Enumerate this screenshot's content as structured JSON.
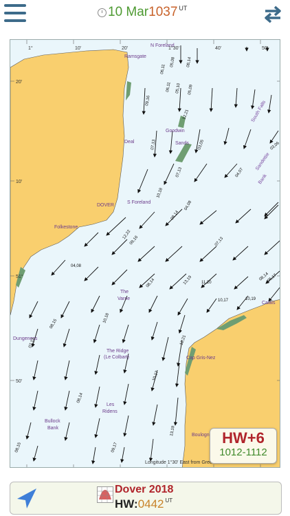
{
  "topbar": {
    "date": "10 Mar",
    "time": "1037",
    "ut": "UT"
  },
  "chart": {
    "places": {
      "north_foreland": "N Foreland",
      "ramsgate": "Ramsgate",
      "deal": "Deal",
      "dover": "DOVER",
      "s_foreland": "S Foreland",
      "folkestone": "Folkestone",
      "dungeness": "Dungeness",
      "goodwin": "Goodwin",
      "sands": "Sands",
      "south_falls": "South Falls",
      "sandettie": "Sandettie",
      "bank": "Bank",
      "the_varne": "The\nVarne",
      "the_ridge": "The Ridge",
      "le_colbart": "(Le Colbart)",
      "les_ridens": "Les\nRidens",
      "bullock_bank": "Bullock\nBank",
      "calais": "Calais",
      "cap_gris_nez": "Cap Gris-Nez",
      "boulogne": "Boulogne"
    },
    "longitude_caption": "Longitude 1°30' East from Greenwich",
    "top_ticks": [
      "1°",
      "10'",
      "20'",
      "1°30'",
      "40'",
      "50'"
    ],
    "side_ticks": [
      "20'",
      "10'",
      "51°",
      "50'"
    ],
    "rates": [
      "06,11",
      "05,08",
      "08,14",
      "09,16",
      "06,11",
      "05,10",
      "05,09",
      "12,21",
      "07,13",
      "03,05",
      "03,06",
      "04,07",
      "10,18",
      "07,13",
      "04,08",
      "12,22",
      "08,14",
      "09,16",
      "07,13",
      "04,08",
      "08,14",
      "13,19",
      "11,20",
      "08,14",
      "05,17",
      "10,17",
      "10,19",
      "08,15",
      "10,18",
      "07,13",
      "12,21",
      "10,17",
      "08,14",
      "13,19",
      "08,15",
      "09,17"
    ]
  },
  "hw_box": {
    "title": "HW+6",
    "range": "1012-1112"
  },
  "bottombar": {
    "port": "Dover 2018",
    "hw_label": "HW:",
    "hw_time": "0442",
    "ut": "UT"
  },
  "colors": {
    "land": "#f9cf6e",
    "sea": "#eaf6fb",
    "sandbank": "#6f9e72",
    "accent_green": "#4e9a32",
    "accent_red": "#b0242b"
  }
}
